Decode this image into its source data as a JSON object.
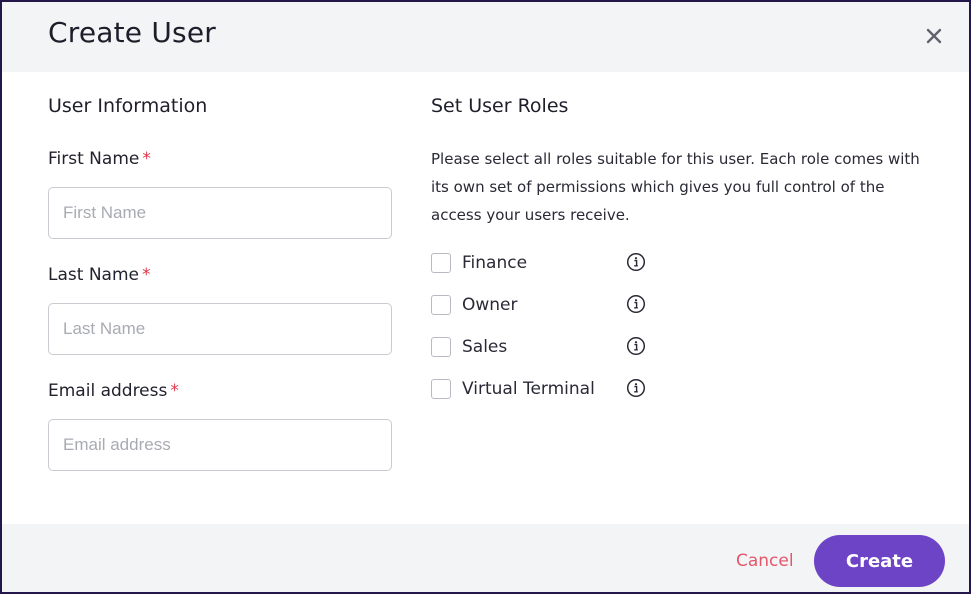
{
  "modal": {
    "title": "Create User",
    "close_icon": "close-icon"
  },
  "user_info": {
    "section_title": "User Information",
    "required_marker": "*",
    "fields": [
      {
        "label": "First Name",
        "placeholder": "First Name",
        "value": ""
      },
      {
        "label": "Last Name",
        "placeholder": "Last Name",
        "value": ""
      },
      {
        "label": "Email address",
        "placeholder": "Email address",
        "value": ""
      }
    ]
  },
  "roles": {
    "section_title": "Set User Roles",
    "description": "Please select all roles suitable for this user. Each role comes with its own set of permissions which gives you full control of the access your users receive.",
    "items": [
      {
        "label": "Finance",
        "checked": false,
        "icon": "info-icon"
      },
      {
        "label": "Owner",
        "checked": false,
        "icon": "info-icon"
      },
      {
        "label": "Sales",
        "checked": false,
        "icon": "info-icon"
      },
      {
        "label": "Virtual Terminal",
        "checked": false,
        "icon": "info-icon"
      }
    ]
  },
  "footer": {
    "cancel_label": "Cancel",
    "create_label": "Create"
  },
  "colors": {
    "accent": "#6e44c7",
    "cancel": "#e2576a",
    "required": "#e0354a",
    "border": "#23164a"
  }
}
